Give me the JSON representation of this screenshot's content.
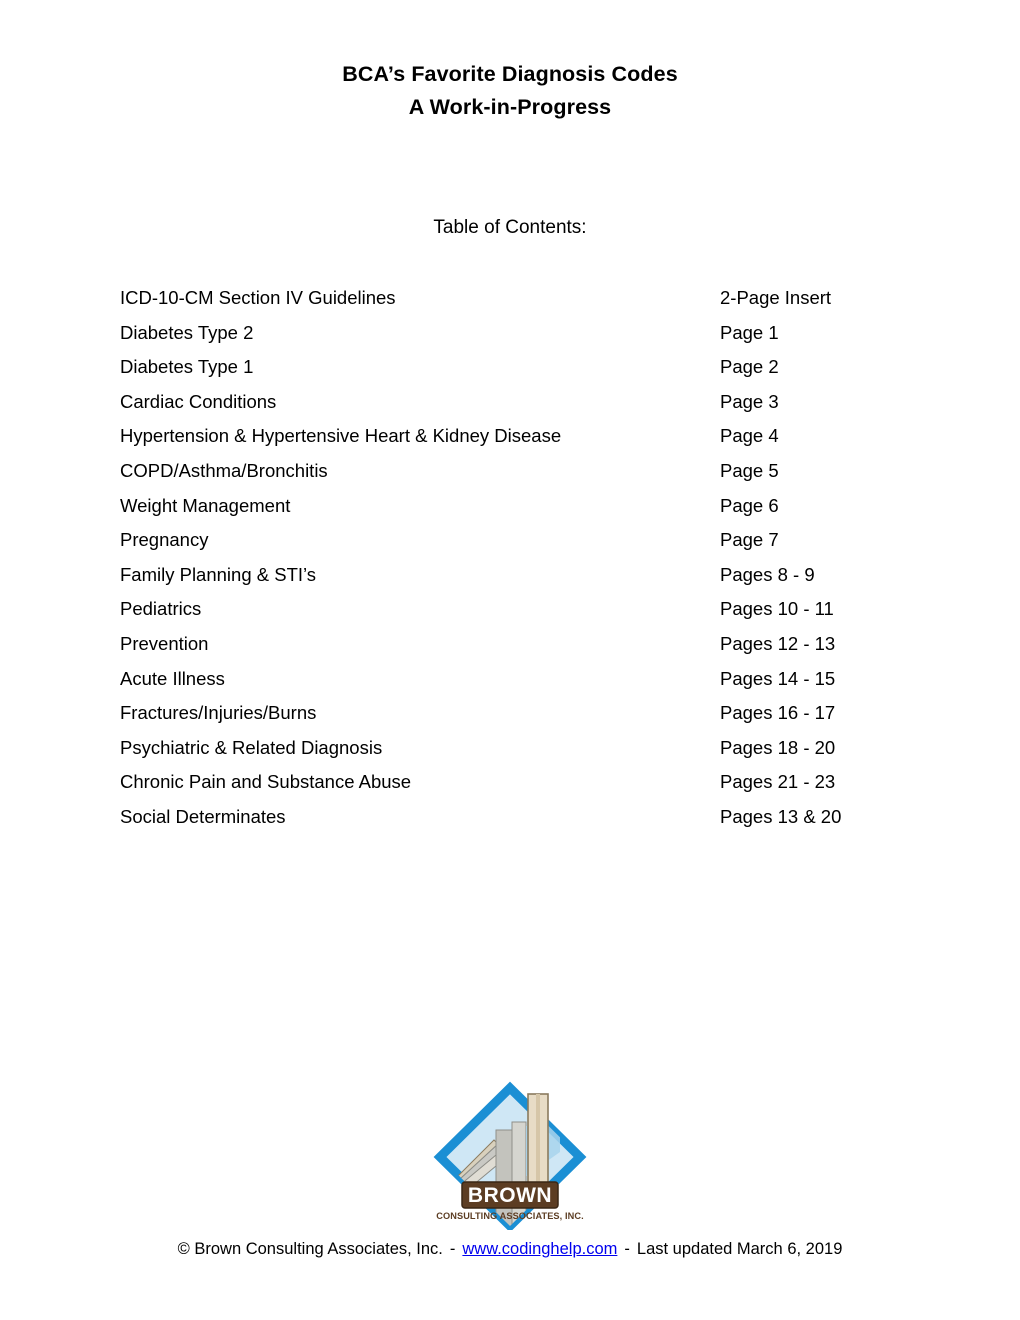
{
  "document": {
    "title_line_1": "BCA’s Favorite Diagnosis Codes",
    "title_line_2": "A Work-in-Progress",
    "toc_heading": "Table of Contents:"
  },
  "toc": {
    "entries": [
      {
        "label": "ICD-10-CM Section IV Guidelines",
        "page": "2-Page Insert"
      },
      {
        "label": "Diabetes Type 2",
        "page": "Page 1"
      },
      {
        "label": "Diabetes Type 1",
        "page": "Page 2"
      },
      {
        "label": "Cardiac Conditions",
        "page": "Page 3"
      },
      {
        "label": "Hypertension & Hypertensive Heart & Kidney Disease",
        "page": "Page 4"
      },
      {
        "label": "COPD/Asthma/Bronchitis",
        "page": "Page 5"
      },
      {
        "label": "Weight Management",
        "page": "Page 6"
      },
      {
        "label": "Pregnancy",
        "page": "Page 7"
      },
      {
        "label": "Family Planning & STI’s",
        "page": "Pages 8 - 9"
      },
      {
        "label": "Pediatrics",
        "page": "Pages 10 - 11"
      },
      {
        "label": "Prevention",
        "page": "Pages 12 - 13"
      },
      {
        "label": "Acute Illness",
        "page": "Pages 14 - 15"
      },
      {
        "label": "Fractures/Injuries/Burns",
        "page": "Pages 16 - 17"
      },
      {
        "label": "Psychiatric & Related Diagnosis",
        "page": "Pages 18 - 20"
      },
      {
        "label": "Chronic Pain and Substance Abuse",
        "page": "Pages 21 - 23"
      },
      {
        "label": "Social Determinates",
        "page": "Pages 13 & 20"
      }
    ]
  },
  "logo": {
    "icon_name": "brown-consulting-associates-logo",
    "company_name": "BROWN",
    "company_tagline": "CONSULTING ASSOCIATES, INC.",
    "diamond_border_color": "#1b8fd4",
    "diamond_fill_color": "#cfe7f5",
    "banner_color": "#5c3d23",
    "column_tan_color": "#e8dcc6",
    "column_gray_color": "#b9b9b3",
    "tagline_color": "#5c3d23"
  },
  "footer": {
    "copyright": "© Brown Consulting Associates, Inc.",
    "separator": "-",
    "website": "www.codinghelp.com",
    "last_updated": "Last updated March 6, 2019",
    "link_color": "#0000ee"
  }
}
